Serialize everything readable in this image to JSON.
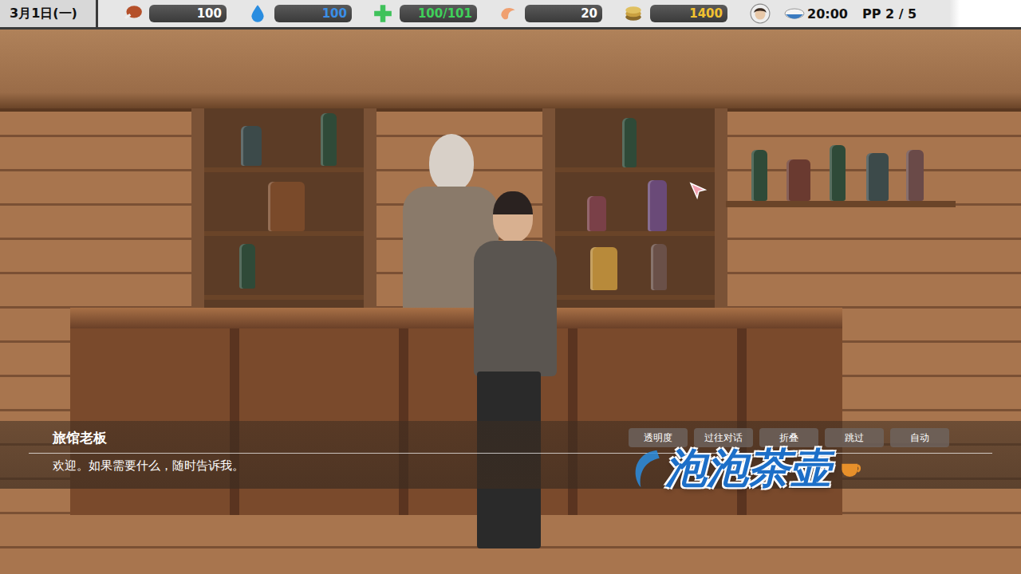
{
  "hud": {
    "date": "3月1日(一)",
    "stats": [
      {
        "value": "100",
        "color": "#ffffff"
      },
      {
        "value": "100",
        "color": "#3a8fe8"
      },
      {
        "value": "100/101",
        "color": "#3fd15a"
      },
      {
        "value": "20",
        "color": "#ffffff"
      },
      {
        "value": "1400",
        "color": "#f2c230"
      }
    ],
    "time": "20:00",
    "pp": "PP 2 / 5"
  },
  "dialogue": {
    "speaker": "旅馆老板",
    "text": "欢迎。如果需要什么，随时告诉我。",
    "buttons": [
      "透明度",
      "过往对话",
      "折叠",
      "跳过",
      "自动"
    ]
  },
  "logo": {
    "text": "泡泡茶壶"
  }
}
